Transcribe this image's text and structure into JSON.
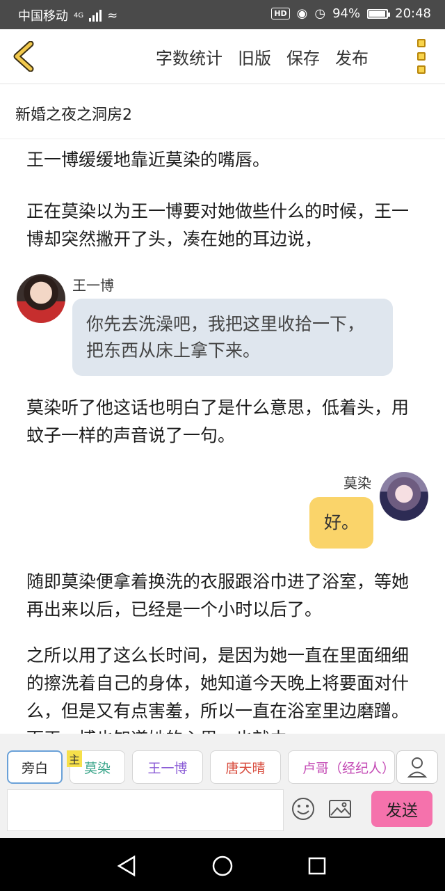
{
  "status_bar": {
    "carrier": "中国移动",
    "network": "4G",
    "hd": "HD",
    "battery": "94%",
    "battery_level": 0.94,
    "time": "20:48"
  },
  "toolbar": {
    "word_count": "字数统计",
    "old_version": "旧版",
    "save": "保存",
    "publish": "发布"
  },
  "story_title": "新婚之夜之洞房2",
  "content": {
    "para1": "王一博缓缓地靠近莫染的嘴唇。",
    "para2": "正在莫染以为王一博要对她做些什么的时候，王一博却突然撇开了头，凑在她的耳边说，",
    "msg1": {
      "speaker": "王一博",
      "text": "你先去洗澡吧，我把这里收拾一下，把东西从床上拿下来。"
    },
    "para3": "莫染听了他这话也明白了是什么意思，低着头，用蚊子一样的声音说了一句。",
    "msg2": {
      "speaker": "莫染",
      "text": "好。"
    },
    "para4": "随即莫染便拿着换洗的衣服跟浴巾进了浴室，等她再出来以后，已经是一个小时以后了。",
    "para5": "之所以用了这么长时间，是因为她一直在里面细细的擦洗着自己的身体，她知道今天晚上将要面对什么，但是又有点害羞，所以一直在浴室里边磨蹭。而王一博也知道她的心思，也就由"
  },
  "roles": {
    "narrator": "旁白",
    "main_badge": "主",
    "role1": "莫染",
    "role2": "王一博",
    "role3": "唐天晴",
    "role4": "卢哥（经纪人）"
  },
  "compose": {
    "input_value": "",
    "send": "发送"
  },
  "colors": {
    "status_bar": "#4a4a4a",
    "accent_yellow": "#fad46a",
    "send_pink": "#f572ac",
    "bubble_blue": "#dfe6ee",
    "role1": "#3aa58a",
    "role2": "#8a5bd6",
    "role3": "#d84c3e",
    "role4": "#c44bb5"
  }
}
